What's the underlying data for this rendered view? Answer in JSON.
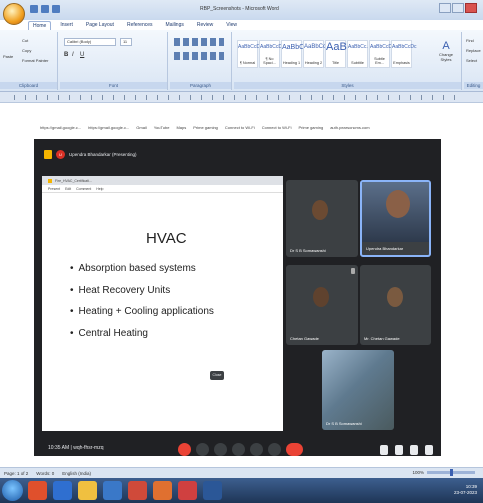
{
  "window": {
    "title": "RBP_Screenshots - Microsoft Word"
  },
  "tabs": [
    "Home",
    "Insert",
    "Page Layout",
    "References",
    "Mailings",
    "Review",
    "View"
  ],
  "ribbon": {
    "clipboard": {
      "label": "Clipboard",
      "paste": "Paste",
      "cut": "Cut",
      "copy": "Copy",
      "format_painter": "Format Painter"
    },
    "font": {
      "label": "Font",
      "name": "Calibri (Body)",
      "size": "11"
    },
    "paragraph": {
      "label": "Paragraph"
    },
    "styles": {
      "label": "Styles",
      "items": [
        {
          "sample": "AaBbCcDc",
          "name": "¶ Normal"
        },
        {
          "sample": "AaBbCcDc",
          "name": "¶ No Spaci..."
        },
        {
          "sample": "AaBbCc",
          "name": "Heading 1"
        },
        {
          "sample": "AaBbCc",
          "name": "Heading 2"
        },
        {
          "sample": "AaB",
          "name": "Title"
        },
        {
          "sample": "AaBbCc.",
          "name": "Subtitle"
        },
        {
          "sample": "AaBbCcDc",
          "name": "Subtle Em..."
        },
        {
          "sample": "AaBbCcDc",
          "name": "Emphasis"
        }
      ],
      "change_styles": "Change Styles"
    },
    "editing": {
      "label": "Editing",
      "find": "Find",
      "replace": "Replace",
      "select": "Select"
    }
  },
  "bookmarks": [
    "https://gmail.google.c...",
    "https://gmail.google.c...",
    "Gmail",
    "YouTube",
    "Maps",
    "Prime gaming",
    "Connect to Wi-Fi",
    "Connect to Wi-Fi",
    "Prime gaming",
    "auth.pearsoncms.com"
  ],
  "meet": {
    "presenter_initial": "U",
    "presenting": "Upendra Bhandarkar (Presenting)",
    "slide": {
      "title": "HVAC",
      "bullets": [
        "Absorption based systems",
        "Heat Recovery Units",
        "Heating + Cooling applications",
        "Central Heating"
      ],
      "close_chip": "Close",
      "browser_tab": "Fire_HVAC_Certificati...",
      "menu": [
        "Present",
        "Edit",
        "Comment",
        "Help"
      ]
    },
    "participants": [
      {
        "name": "Dr S B Somawanshi"
      },
      {
        "name": "Upendra Bhandarkar"
      },
      {
        "name": "Chetan Gawade"
      },
      {
        "name": "Mr. Chetan Gawade"
      },
      {
        "name": "Dr S B Somawanshi"
      }
    ],
    "time": "10:35 AM",
    "meeting_code": "wqh-fhsr-mzq"
  },
  "statusbar": {
    "page": "Page: 1 of 2",
    "words": "Words: 0",
    "language": "English (India)",
    "zoom": "100%"
  },
  "taskbar": {
    "time": "10:39",
    "date": "23-07-2023"
  }
}
